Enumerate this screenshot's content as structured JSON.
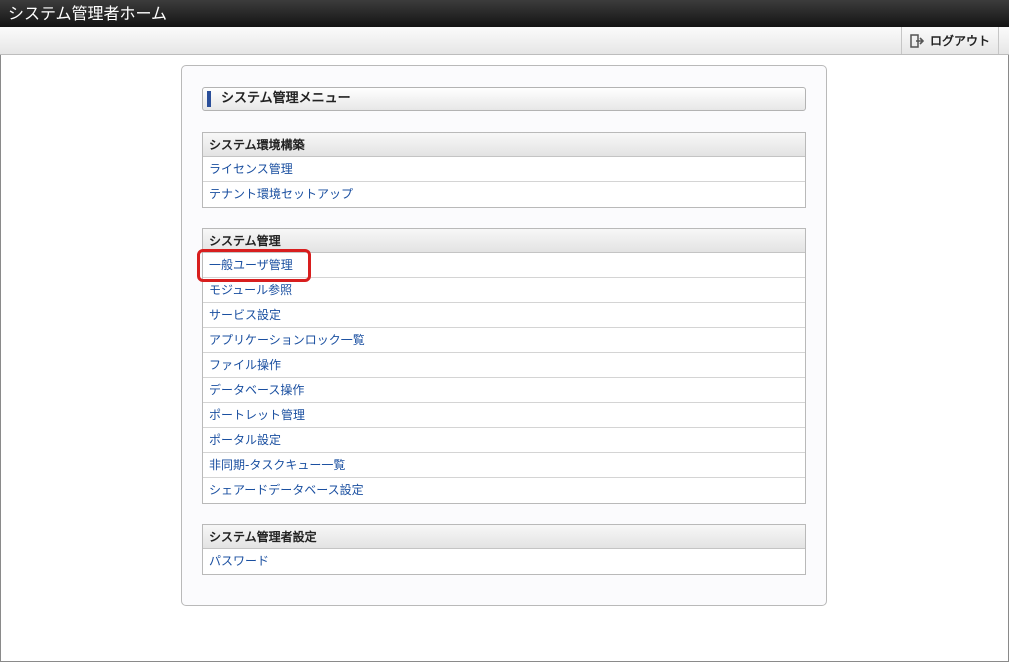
{
  "window": {
    "title": "システム管理者ホーム"
  },
  "toolbar": {
    "logout_label": "ログアウト"
  },
  "menu": {
    "title": "システム管理メニュー",
    "sections": [
      {
        "header": "システム環境構築",
        "items": [
          "ライセンス管理",
          "テナント環境セットアップ"
        ]
      },
      {
        "header": "システム管理",
        "items": [
          "一般ユーザ管理",
          "モジュール参照",
          "サービス設定",
          "アプリケーションロック一覧",
          "ファイル操作",
          "データベース操作",
          "ポートレット管理",
          "ポータル設定",
          "非同期-タスクキュー一覧",
          "シェアードデータベース設定"
        ]
      },
      {
        "header": "システム管理者設定",
        "items": [
          "パスワード"
        ]
      }
    ]
  },
  "colors": {
    "accent": "#2b4f9a",
    "link": "#1a4fa0",
    "highlight": "#d81e1e"
  },
  "icons": {
    "logout": "logout-icon"
  }
}
